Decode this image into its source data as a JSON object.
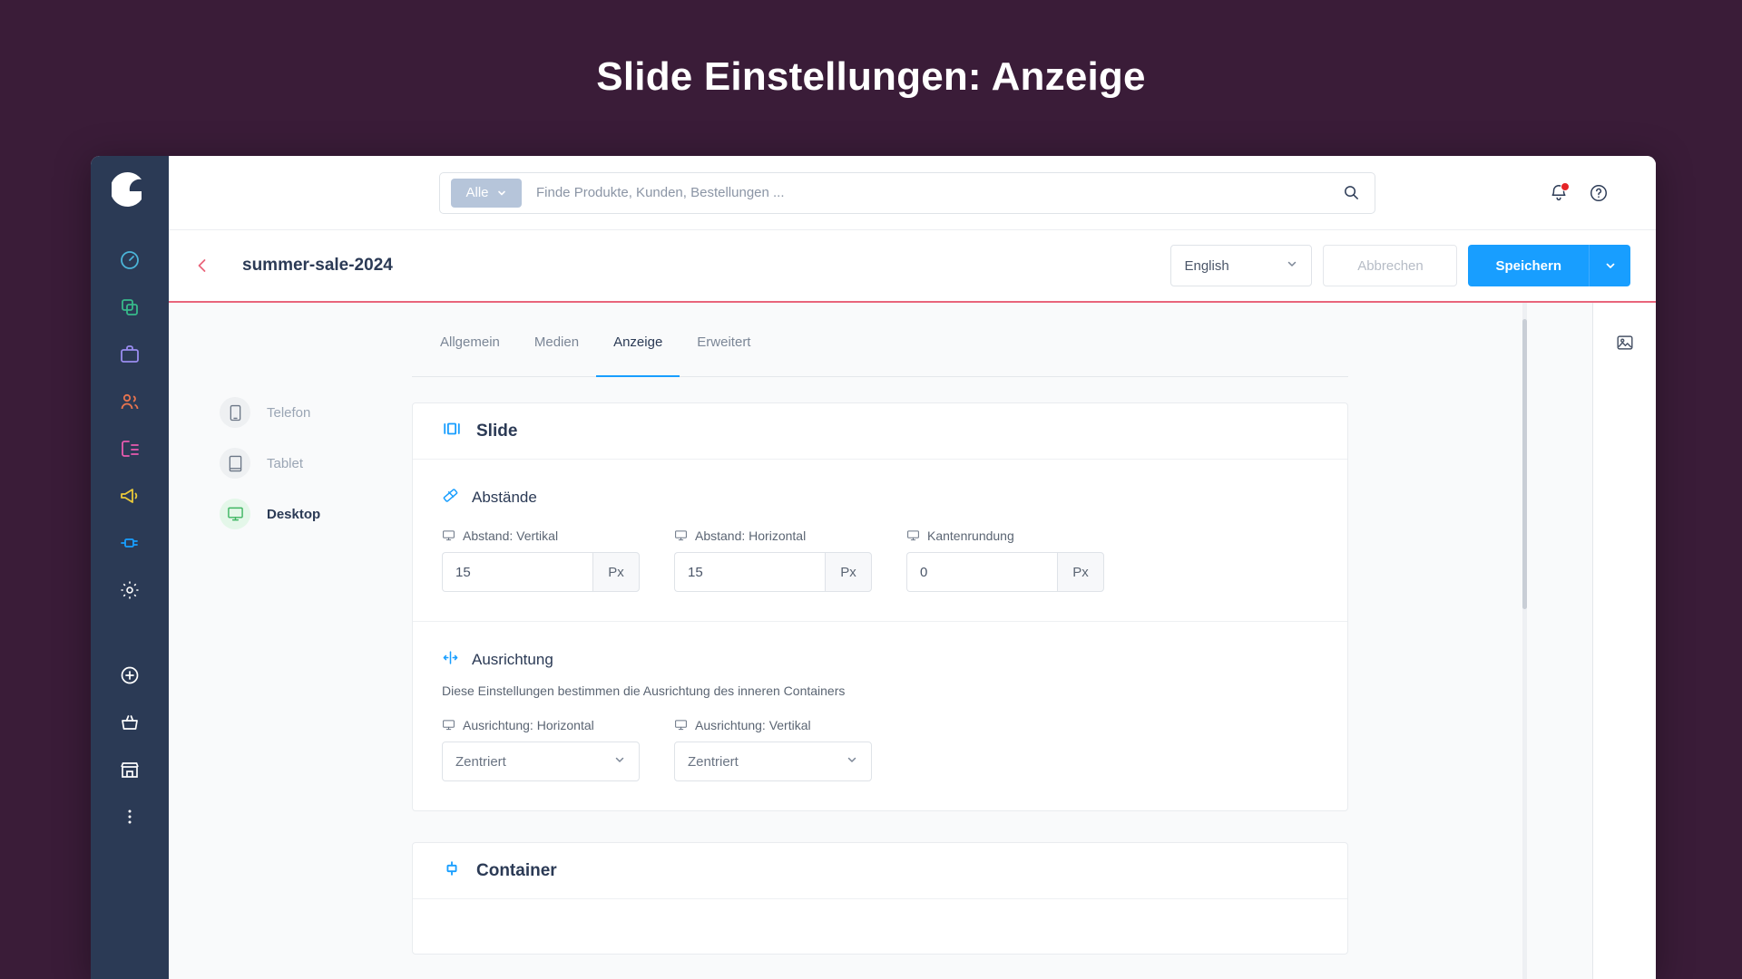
{
  "banner": {
    "title": "Slide Einstellungen: Anzeige"
  },
  "colors": {
    "banner_bg": "#3a1c38",
    "rail_bg": "#2b3a55",
    "accent_blue": "#189eff",
    "accent_pink": "#e9657b",
    "badge_red": "#e52427",
    "desktop_green": "#3eb662"
  },
  "rail": {
    "logo_name": "shopware-logo",
    "items": [
      {
        "name": "dashboard-icon",
        "color": "#4bb4d8"
      },
      {
        "name": "catalogue-icon",
        "color": "#37b98a"
      },
      {
        "name": "orders-icon",
        "color": "#9a8cf0"
      },
      {
        "name": "customers-icon",
        "color": "#e8744e"
      },
      {
        "name": "content-icon",
        "color": "#e95bb0"
      },
      {
        "name": "marketing-icon",
        "color": "#e9c939"
      },
      {
        "name": "extensions-icon",
        "color": "#189eff"
      },
      {
        "name": "settings-icon",
        "color": "#ffffff"
      },
      {
        "name": "add-icon",
        "color": "#ffffff"
      },
      {
        "name": "basket-icon",
        "color": "#ffffff"
      },
      {
        "name": "storefront-icon",
        "color": "#ffffff"
      },
      {
        "name": "more-icon",
        "color": "#ffffff"
      }
    ]
  },
  "search": {
    "scope_label": "Alle",
    "placeholder": "Finde Produkte, Kunden, Bestellungen ..."
  },
  "topbar": {
    "notifications_label": "Benachrichtigungen",
    "help_label": "Hilfe"
  },
  "actionbar": {
    "title": "summer-sale-2024",
    "language": "English",
    "cancel_label": "Abbrechen",
    "save_label": "Speichern"
  },
  "devices": [
    {
      "label": "Telefon",
      "icon": "mobile-icon",
      "active": false
    },
    {
      "label": "Tablet",
      "icon": "tablet-icon",
      "active": false
    },
    {
      "label": "Desktop",
      "icon": "desktop-icon",
      "active": true
    }
  ],
  "tabs": [
    {
      "label": "Allgemein",
      "active": false
    },
    {
      "label": "Medien",
      "active": false
    },
    {
      "label": "Anzeige",
      "active": true
    },
    {
      "label": "Erweitert",
      "active": false
    }
  ],
  "slide_card": {
    "title": "Slide",
    "icon": "slide-icon",
    "spacing": {
      "title": "Abstände",
      "icon": "ruler-icon",
      "fields": [
        {
          "label": "Abstand: Vertikal",
          "value": "15",
          "unit": "Px"
        },
        {
          "label": "Abstand: Horizontal",
          "value": "15",
          "unit": "Px"
        },
        {
          "label": "Kantenrundung",
          "value": "0",
          "unit": "Px"
        }
      ]
    },
    "alignment": {
      "title": "Ausrichtung",
      "icon": "align-icon",
      "description": "Diese Einstellungen bestimmen die Ausrichtung des inneren Containers",
      "fields": [
        {
          "label": "Ausrichtung: Horizontal",
          "value": "Zentriert"
        },
        {
          "label": "Ausrichtung: Vertikal",
          "value": "Zentriert"
        }
      ]
    }
  },
  "container_card": {
    "title": "Container",
    "icon": "container-icon"
  },
  "aside": {
    "media_label": "Medien"
  }
}
